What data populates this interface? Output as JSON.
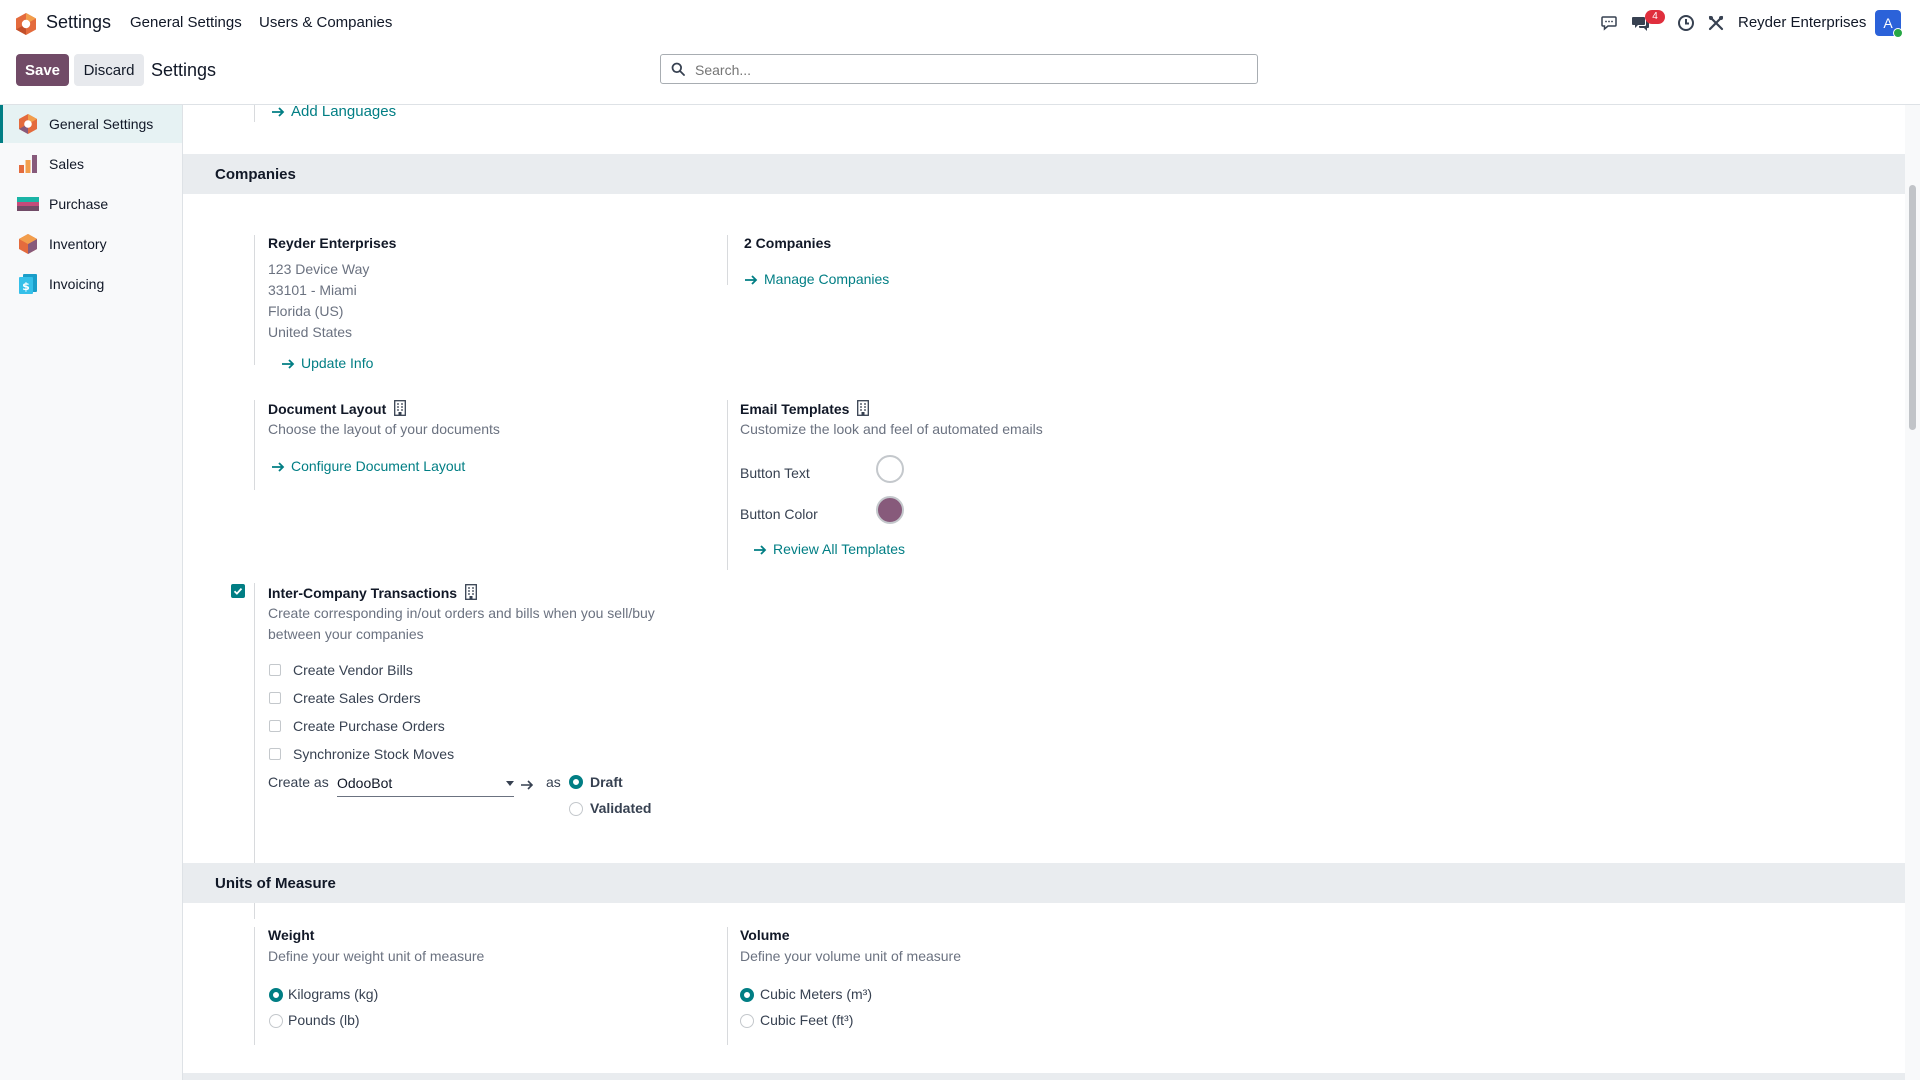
{
  "navbar": {
    "app_name": "Settings",
    "menu": [
      "General Settings",
      "Users & Companies"
    ],
    "notification_count": "4",
    "company": "Reyder Enterprises",
    "avatar_letter": "A"
  },
  "control": {
    "save_label": "Save",
    "discard_label": "Discard",
    "title": "Settings",
    "search_placeholder": "Search..."
  },
  "sidebar": {
    "items": [
      {
        "label": "General Settings",
        "icon": "general-settings-icon"
      },
      {
        "label": "Sales",
        "icon": "sales-icon"
      },
      {
        "label": "Purchase",
        "icon": "purchase-icon"
      },
      {
        "label": "Inventory",
        "icon": "inventory-icon"
      },
      {
        "label": "Invoicing",
        "icon": "invoicing-icon"
      }
    ]
  },
  "languages": {
    "add_link": "Add Languages"
  },
  "companies": {
    "section_title": "Companies",
    "company_name": "Reyder Enterprises",
    "address": [
      "123 Device Way",
      "33101 - Miami",
      "Florida (US)",
      "United States"
    ],
    "update_link": "Update Info",
    "count_label": "2 Companies",
    "manage_link": "Manage Companies",
    "doc_layout": {
      "title": "Document Layout",
      "desc": "Choose the layout of your documents",
      "link": "Configure Document Layout"
    },
    "email_templates": {
      "title": "Email Templates",
      "desc": "Customize the look and feel of automated emails",
      "button_text_label": "Button Text",
      "button_color_label": "Button Color",
      "button_text_color": "#ffffff",
      "button_color": "#875a7b",
      "link": "Review All Templates"
    },
    "inter_company": {
      "enabled": true,
      "title": "Inter-Company Transactions",
      "desc_line1": "Create corresponding in/out orders and bills when you sell/buy",
      "desc_line2": "between your companies",
      "options": [
        {
          "label": "Create Vendor Bills",
          "checked": false
        },
        {
          "label": "Create Sales Orders",
          "checked": false
        },
        {
          "label": "Create Purchase Orders",
          "checked": false
        },
        {
          "label": "Synchronize Stock Moves",
          "checked": false
        }
      ],
      "create_as_label": "Create as",
      "create_as_value": "OdooBot",
      "as_label": "as",
      "state_options": [
        {
          "label": "Draft",
          "selected": true
        },
        {
          "label": "Validated",
          "selected": false
        }
      ]
    }
  },
  "units": {
    "section_title": "Units of Measure",
    "weight": {
      "title": "Weight",
      "desc": "Define your weight unit of measure",
      "options": [
        {
          "label": "Kilograms (kg)",
          "selected": true
        },
        {
          "label": "Pounds (lb)",
          "selected": false
        }
      ]
    },
    "volume": {
      "title": "Volume",
      "desc": "Define your volume unit of measure",
      "options": [
        {
          "label": "Cubic Meters (m³)",
          "selected": true
        },
        {
          "label": "Cubic Feet (ft³)",
          "selected": false
        }
      ]
    }
  },
  "colors": {
    "primary": "#714b67",
    "accent": "#017e84"
  }
}
